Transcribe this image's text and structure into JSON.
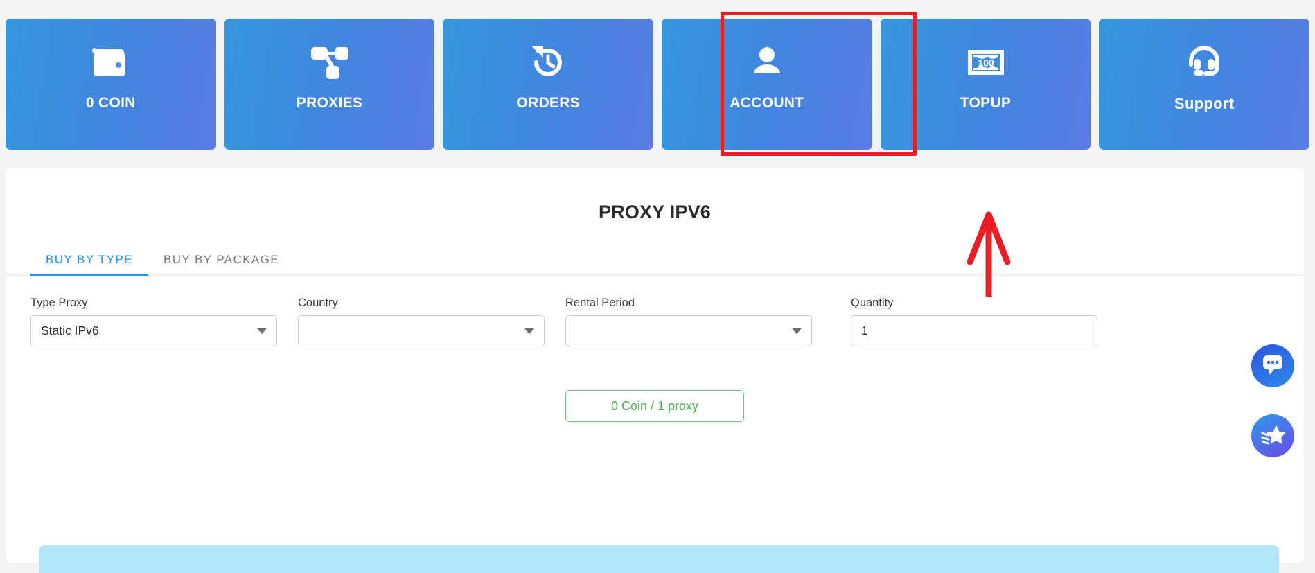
{
  "nav": {
    "tiles": [
      {
        "label": "0 COIN",
        "icon": "wallet-icon",
        "name": "nav-tile-coin",
        "style": "upper"
      },
      {
        "label": "PROXIES",
        "icon": "network-icon",
        "name": "nav-tile-proxies",
        "style": "upper"
      },
      {
        "label": "ORDERS",
        "icon": "history-icon",
        "name": "nav-tile-orders",
        "style": "upper"
      },
      {
        "label": "ACCOUNT",
        "icon": "user-icon",
        "name": "nav-tile-account",
        "style": "upper"
      },
      {
        "label": "TOPUP",
        "icon": "banknote-icon",
        "name": "nav-tile-topup",
        "style": "upper",
        "badge": "100"
      },
      {
        "label": "Support",
        "icon": "headset-icon",
        "name": "nav-tile-support",
        "style": "mixed"
      }
    ],
    "highlight_target": "TOPUP",
    "highlight_color": "#ec1c24"
  },
  "main": {
    "title": "PROXY IPV6",
    "tabs": [
      {
        "label": "BUY BY TYPE",
        "active": true
      },
      {
        "label": "BUY BY PACKAGE",
        "active": false
      }
    ],
    "fields": [
      {
        "label": "Type Proxy",
        "value": "Static IPv6",
        "placeholder": "",
        "kind": "select"
      },
      {
        "label": "Country",
        "value": "",
        "placeholder": "",
        "kind": "select"
      },
      {
        "label": "Rental Period",
        "value": "",
        "placeholder": "",
        "kind": "select"
      },
      {
        "label": "Quantity",
        "value": "1",
        "placeholder": "",
        "kind": "input"
      }
    ],
    "cta_label": "0 Coin / 1 proxy",
    "cta_color": "#4caf50"
  },
  "widgets": {
    "chat_icon": "chat-bubble-icon",
    "star_icon": "shooting-star-icon"
  },
  "theme": {
    "page_bg": "#f2f3f5",
    "tile_gradient_from": "#3597dd",
    "tile_gradient_to": "#5b7ce2",
    "accent_blue": "#2196f3",
    "info_bar": "#b3e5fc"
  }
}
